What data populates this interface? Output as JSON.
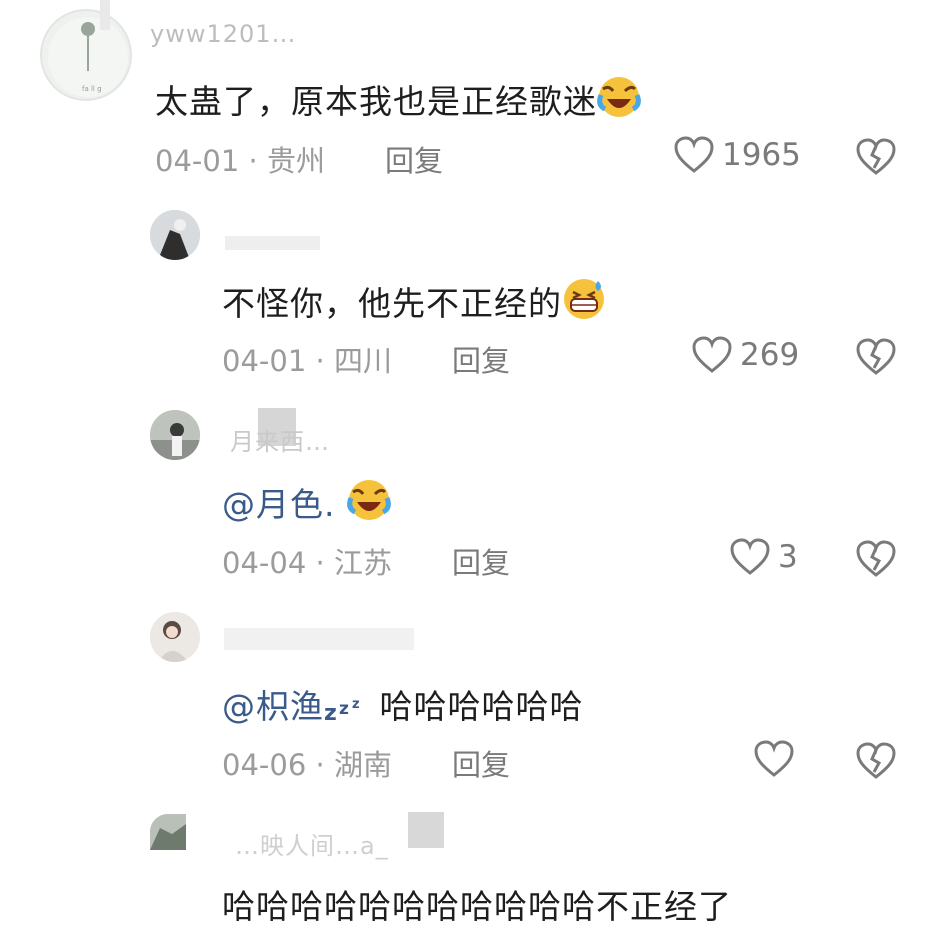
{
  "comments": [
    {
      "username": "yww1201…",
      "text": "太蛊了，原本我也是正经歌迷",
      "date": "04-01",
      "location": "贵州",
      "reply": "回复",
      "likes": "1965",
      "emoji": "laugh-cry-emoji"
    },
    {
      "username": "",
      "text": "不怪你，他先不正经的",
      "date": "04-01",
      "location": "四川",
      "reply": "回复",
      "likes": "269",
      "emoji": "grin-sweat-emoji"
    },
    {
      "username": "月来西…",
      "mention": "@月色.",
      "text": "",
      "date": "04-04",
      "location": "江苏",
      "reply": "回复",
      "likes": "3",
      "emoji": "laugh-cry-emoji"
    },
    {
      "username": "",
      "mention": "@枳渔",
      "text": "哈哈哈哈哈哈",
      "date": "04-06",
      "location": "湖南",
      "reply": "回复",
      "likes": "",
      "emoji": "zzz-emoji"
    },
    {
      "username": "…映人间…a_",
      "text": "哈哈哈哈哈哈哈哈哈哈哈不正经了"
    }
  ],
  "separator": "·"
}
